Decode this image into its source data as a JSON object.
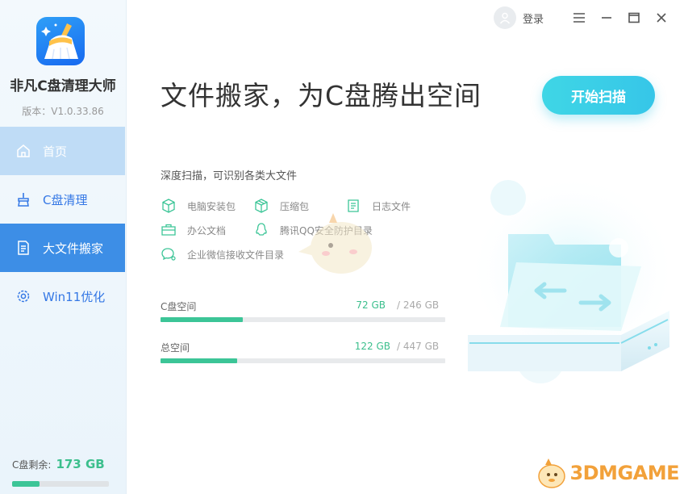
{
  "app": {
    "name": "非凡C盘清理大师",
    "version": "版本：V1.0.33.86"
  },
  "nav": [
    {
      "label": "首页"
    },
    {
      "label": "C盘清理"
    },
    {
      "label": "大文件搬家"
    },
    {
      "label": "Win11优化"
    }
  ],
  "disk_remaining": {
    "label": "C盘剩余:",
    "value": "173 GB",
    "fill_fraction": 0.28
  },
  "topbar": {
    "login_label": "登录"
  },
  "main": {
    "title": "文件搬家，为C盘腾出空间",
    "start_button": "开始扫描",
    "subtitle": "深度扫描，可识别各类大文件",
    "features": [
      {
        "label": "电脑安装包",
        "icon": "package-box-icon"
      },
      {
        "label": "压缩包",
        "icon": "archive-icon"
      },
      {
        "label": "日志文件",
        "icon": "log-file-icon"
      },
      {
        "label": "办公文档",
        "icon": "briefcase-icon"
      },
      {
        "label": "腾讯QQ安全防护目录",
        "icon": "qq-penguin-icon"
      },
      {
        "label": "企业微信接收文件目录",
        "icon": "wecom-chat-icon"
      }
    ]
  },
  "space": {
    "c_drive": {
      "label": "C盘空间",
      "used": "72 GB",
      "total": "/ 246 GB",
      "fraction": 0.29
    },
    "total": {
      "label": "总空间",
      "used": "122 GB",
      "total": "/ 447 GB",
      "fraction": 0.27
    }
  },
  "watermark": {
    "text": "3DMGAME"
  },
  "colors": {
    "accent": "#3d8ee6",
    "green": "#3cc597",
    "cyan": "#3fd6e6"
  }
}
